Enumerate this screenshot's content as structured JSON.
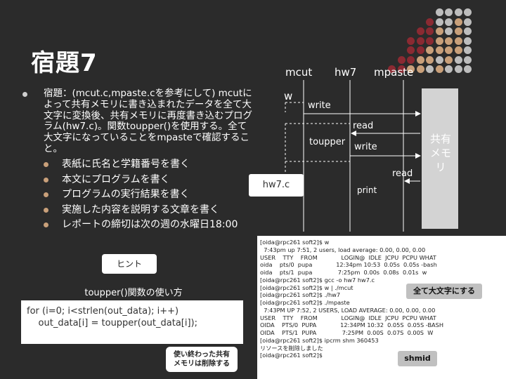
{
  "slide": {
    "title": "宿題7",
    "main_text": "宿題：(mcut.c,mpaste.cを参考にして) mcutによって共有メモリに書き込まれたデータを全て大文字に変換後、共有メモリに再度書き込むプログラム(hw7.c)。関数toupper()を使用する。全て大文字になっていることをmpasteで確認すること。",
    "sub_items": [
      "表紙に氏名と学籍番号を書く",
      "本文にプログラムを書く",
      "プログラムの実行結果を書く",
      "実施した内容を説明する文章を書く",
      "レポートの締切は次の週の水曜日18:00"
    ],
    "hint_label": "ヒント",
    "hint_subtitle": "toupper()関数の使い方",
    "code_lines": [
      "for (i=0; i<strlen(out_data); i++)",
      "    out_data[i] = toupper(out_data[i]);"
    ],
    "free_note_line1": "使い終わった共有",
    "free_note_line2": "メモリは削除する"
  },
  "diagram": {
    "col_mcut": "mcut",
    "col_hw7": "hw7",
    "col_mpaste": "mpaste",
    "w_label": "w",
    "write1": "write",
    "read1": "read",
    "toupper": "toupper",
    "write2": "write",
    "read2": "read",
    "print": "print",
    "hw7c": "hw7.c",
    "shm_line1": "共有",
    "shm_line2": "メモリ"
  },
  "terminal": {
    "lines": [
      "[oida@rpc261 soft2]$ w",
      "  7:43pm up 7:51, 2 users, load average: 0.00, 0.00, 0.00",
      "USER    TTY    FROM             LOGIN@  IDLE  JCPU  PCPU WHAT",
      "oida    pts/0  pupa             12:34pm 10:53  0.05s  0.05s -bash",
      "oida    pts/1  pupa              7:25pm  0.00s  0.08s  0.01s  w",
      "[oida@rpc261 soft2]$ gcc -o hw7 hw7.c",
      "[oida@rpc261 soft2]$ w | ./mcut",
      "[oida@rpc261 soft2]$ ./hw7",
      "[oida@rpc261 soft2]$ ./mpaste",
      "  7:43PM UP 7:52, 2 USERS, LOAD AVERAGE: 0.00, 0.00, 0.00",
      "USER    TTY    FROM             LOGIN@  IDLE  JCPU  PCPU WHAT",
      "OIDA    PTS/0  PUPA             12:34PM 10:32  0.05S  0.05S -BASH",
      "OIDA    PTS/1  PUPA              7:25PM  0.00S  0.07S  0.00S  W",
      "[oida@rpc261 soft2]$ ipcrm shm 360453",
      "リソースを削除しました",
      "[oida@rpc261 soft2]$"
    ],
    "callout_upper": "全て大文字にする",
    "callout_shmid": "shmid"
  },
  "colors": {
    "background": "#2b2b2b",
    "accent_red": "#8b2a32",
    "accent_tan": "#c9a07a",
    "dot_gray": "#bdbdbd"
  }
}
